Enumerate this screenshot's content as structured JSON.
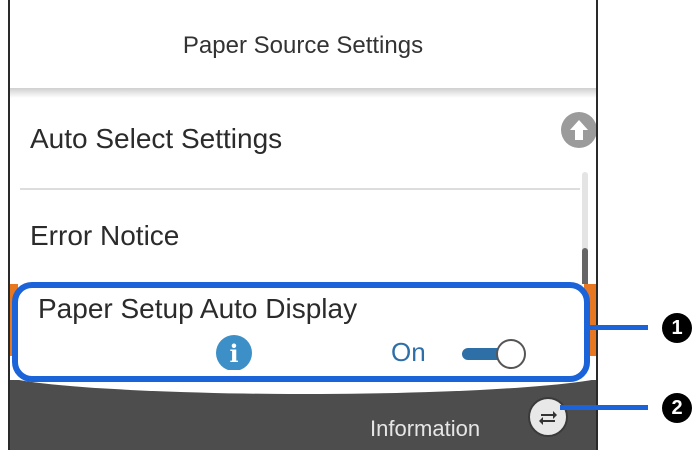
{
  "header": {
    "title": "Paper Source Settings"
  },
  "menu": {
    "items": [
      {
        "label": "Auto Select Settings"
      },
      {
        "label": "Error Notice"
      },
      {
        "label": "Paper Setup Auto Display",
        "value_label": "On",
        "toggle_state": true
      }
    ]
  },
  "scroll": {
    "up_icon": "arrow-up-icon",
    "position_fraction": 0.85
  },
  "info_icon": {
    "glyph": "i"
  },
  "bottom_bar": {
    "label": "Information",
    "switch_icon": "swap-arrows-icon"
  },
  "callouts": [
    {
      "number": "1"
    },
    {
      "number": "2"
    }
  ],
  "colors": {
    "highlight": "#1a63d8",
    "selection": "#e87722",
    "toggle_on": "#2f6fa8",
    "bottom_bar": "#4d4d4d"
  }
}
